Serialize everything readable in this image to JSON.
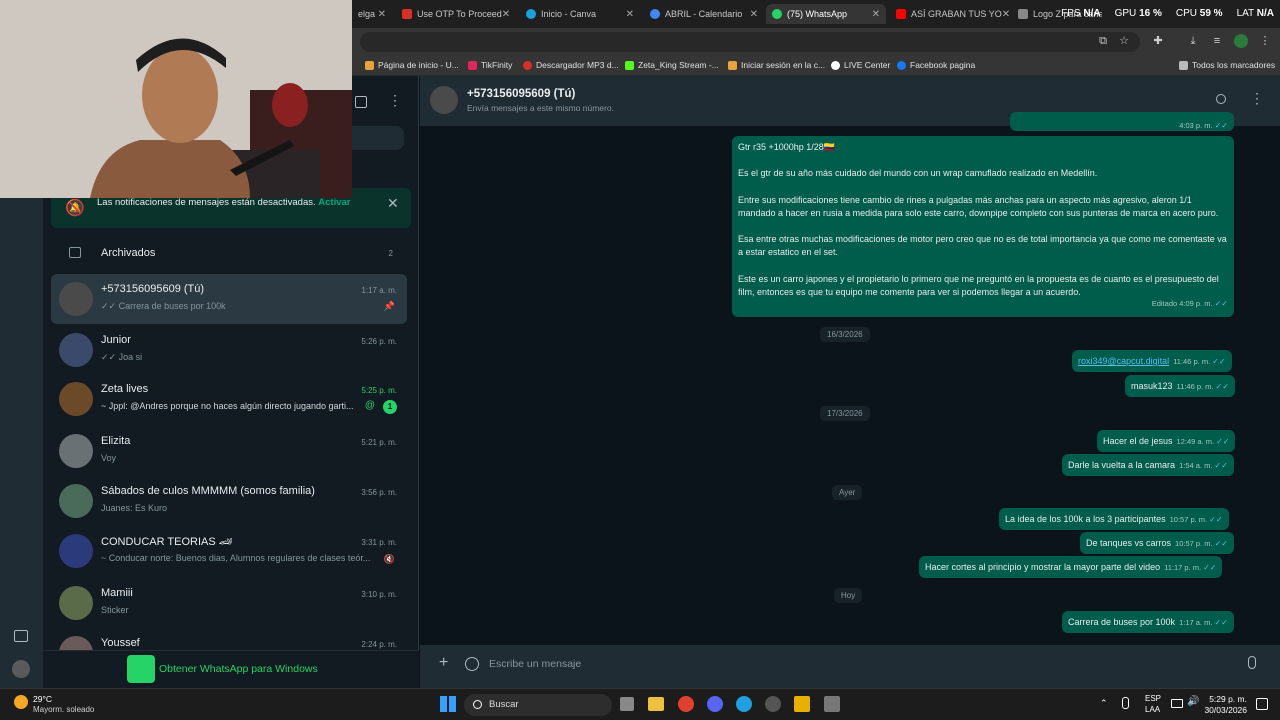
{
  "browser": {
    "tabs": [
      {
        "label": "elga",
        "color": "#555555"
      },
      {
        "label": "Use OTP To Proceed",
        "color": "#d93025"
      },
      {
        "label": "Inicio - Canva",
        "color": "#1ba0d8"
      },
      {
        "label": "ABRIL - Calendario",
        "color": "#4285f4"
      },
      {
        "label": "(75) WhatsApp",
        "color": "#25d366"
      },
      {
        "label": "ASÍ GRABAN TUS YO",
        "color": "#ff0000"
      },
      {
        "label": "Logo Z para canal",
        "color": "#888888"
      }
    ],
    "tab_close": "✕",
    "bookmarks": [
      {
        "label": "Página de inicio - U...",
        "color": "#e8a33d"
      },
      {
        "label": "TikFinity",
        "color": "#e0245e"
      },
      {
        "label": "Descargador MP3 d...",
        "color": "#d93025"
      },
      {
        "label": "Zeta_King Stream -...",
        "color": "#53fc18"
      },
      {
        "label": "Iniciar sesión en la c...",
        "color": "#e8a33d"
      },
      {
        "label": "LIVE Center",
        "color": "#ffffff"
      },
      {
        "label": "Facebook pagina",
        "color": "#1877f2"
      }
    ],
    "all_bookmarks": "Todos los marcadores"
  },
  "perf": {
    "fps_label": "FPS",
    "fps": "N/A",
    "gpu_label": "GPU",
    "gpu": "16 %",
    "cpu_label": "CPU",
    "cpu": "59 %",
    "lat_label": "LAT",
    "lat": "N/A"
  },
  "sidebar": {
    "notification": "Las notificaciones de mensajes están desactivadas.",
    "notification_action": "Activar",
    "archived_label": "Archivados",
    "archived_count": "2",
    "chats": [
      {
        "name": "+573156095609 (Tú)",
        "preview": "✓✓ Carrera de buses por 100k",
        "time": "1:17 a. m.",
        "color": "#4a4a4a"
      },
      {
        "name": "Junior",
        "preview": "✓✓ Joa si",
        "time": "5:26 p. m.",
        "color": "#3b4a6b"
      },
      {
        "name": "Zeta lives",
        "preview": "~ Jppl: @Andres porque no haces algún directo jugando garti...",
        "time": "5:25 p. m.",
        "color": "#6b4a2a",
        "unread": "1"
      },
      {
        "name": "Elizita",
        "preview": "Voy",
        "time": "5:21 p. m.",
        "color": "#6a7175"
      },
      {
        "name": "Sábados de culos MMMMM (somos familia)",
        "preview": "Juanes: Es Kuro",
        "time": "3:56 p. m.",
        "color": "#4a6b5a"
      },
      {
        "name": "CONDUCAR TEORIAS 🏎",
        "preview": "~ Conducar norte: Buenos dias, Alumnos regulares de clases teór...",
        "time": "3:31 p. m.",
        "color": "#2a3a7a"
      },
      {
        "name": "Mamiii",
        "preview": "Sticker",
        "time": "3:10 p. m.",
        "color": "#5a6b4a"
      },
      {
        "name": "Youssef",
        "preview": "",
        "time": "2:24 p. m.",
        "color": "#6b5a5a"
      }
    ],
    "get_app": "Obtener WhatsApp para Windows"
  },
  "chat": {
    "title": "+573156095609 (Tú)",
    "subtitle": "Envía mensajes a este mismo número.",
    "top_time": "4:03 p. m.",
    "long_message": {
      "line1": "Gtr r35 +1000hp 1/28🇨🇴",
      "p1": "Es el gtr de su año más cuidado del mundo con un wrap camuflado realizado en Medellín.",
      "p2": "Entre sus modificaciones tiene cambio de rines a pulgadas más anchas para un aspecto más agresivo, aleron 1/1 mandado a hacer en rusia a medida para solo este carro, downpipe completo con sus punteras de marca en acero puro.",
      "p3": "Esa entre otras muchas modificaciones de motor pero creo que no es de total importancia ya que como me comentaste va a estar estatico en el set.",
      "p4": "Este es un carro japones y el propietario lo primero que me preguntó en la propuesta es de cuanto es el presupuesto del film, entonces es que tu equipo me comente para ver si podemos llegar a un acuerdo.",
      "time": "Editado 4:09 p. m."
    },
    "date1": "16/3/2026",
    "m1": {
      "text": "roxi349@capcut.digital",
      "time": "11:46 p. m."
    },
    "m2": {
      "text": "masuk123",
      "time": "11:46 p. m."
    },
    "date2": "17/3/2026",
    "m3": {
      "text": "Hacer el de jesus",
      "time": "12:49 a. m."
    },
    "m4": {
      "text": "Darle la vuelta a la camara",
      "time": "1:54 a. m."
    },
    "date3": "Ayer",
    "m5": {
      "text": "La idea de los 100k a los 3 participantes",
      "time": "10:57 p. m."
    },
    "m6": {
      "text": "De tanques vs carros",
      "time": "10:57 p. m."
    },
    "m7": {
      "text": "Hacer cortes al principio y mostrar la mayor parte del video",
      "time": "11:17 p. m."
    },
    "date4": "Hoy",
    "m8": {
      "text": "Carrera de buses por 100k",
      "time": "1:17 a. m."
    },
    "tick": "✓✓",
    "composer_placeholder": "Escribe un mensaje"
  },
  "taskbar": {
    "weather_temp": "29°C",
    "weather_desc": "Mayorm. soleado",
    "search": "Buscar",
    "lang1": "ESP",
    "lang2": "LAA",
    "time": "5:29 p. m.",
    "date": "30/03/2026"
  }
}
